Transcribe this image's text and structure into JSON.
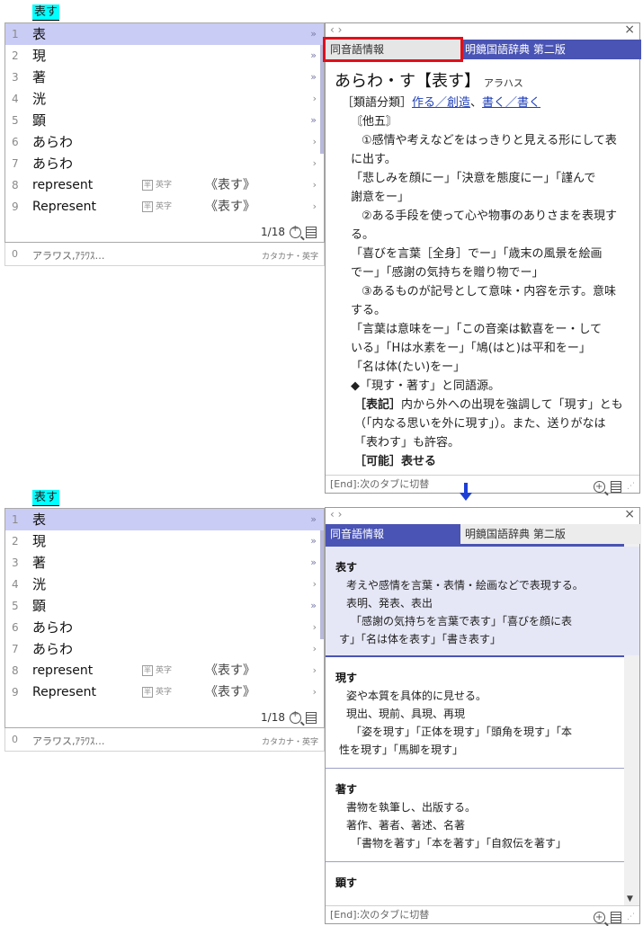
{
  "composition_text": "表す",
  "candidates": [
    {
      "num": "1",
      "word": "表",
      "kind": "",
      "annotation": "",
      "arrow": "»"
    },
    {
      "num": "2",
      "word": "現",
      "kind": "",
      "annotation": "",
      "arrow": "»"
    },
    {
      "num": "3",
      "word": "著",
      "kind": "",
      "annotation": "",
      "arrow": "»"
    },
    {
      "num": "4",
      "word": "洸",
      "kind": "",
      "annotation": "",
      "arrow": "›"
    },
    {
      "num": "5",
      "word": "顕",
      "kind": "",
      "annotation": "",
      "arrow": "»"
    },
    {
      "num": "6",
      "word": "あらわ",
      "kind": "",
      "annotation": "",
      "arrow": "›"
    },
    {
      "num": "7",
      "word": "あらわ",
      "kind": "",
      "annotation": "",
      "arrow": "›"
    },
    {
      "num": "8",
      "word": "represent",
      "kind_box": "半",
      "kind": "英字",
      "annotation": "《表す》",
      "arrow": "›"
    },
    {
      "num": "9",
      "word": "Represent",
      "kind_box": "半",
      "kind": "英字",
      "annotation": "《表す》",
      "arrow": "›"
    }
  ],
  "page_indicator": "1/18",
  "prediction": {
    "num": "0",
    "text": "アラワス,ｱﾗﾜｽ…",
    "type": "カタカナ・英字"
  },
  "dict": {
    "nav": "‹  ›",
    "close": "×",
    "tab_homonym": "同音語情報",
    "tab_meikyo": "明鏡国語辞典 第二版",
    "footer_hint": "[End]:次のタブに切替"
  },
  "meikyo_entry": {
    "headword": "あらわ・す【表す】",
    "reading": "アラハス",
    "category_label": "［類語分類］",
    "category_links": [
      "作る／創造",
      "書く／書く"
    ],
    "category_sep": "、",
    "pos": "〘他五〙",
    "lines": [
      "①感情や考えなどをはっきりと見える形にして表",
      "に出す。",
      "「悲しみを顔にー」「決意を態度にー」「謹んで",
      "謝意をー」",
      "②ある手段を使って心や物事のありさまを表現す",
      "る。",
      "「喜びを言葉［全身］でー」「歳末の風景を絵画",
      "でー」「感謝の気持ちを贈り物でー」",
      "③あるものが記号として意味・内容を示す。意味",
      "する。",
      "「言葉は意味をー」「この音楽は歓喜をー・して",
      "いる」「Hは水素をー」「鳩(はと)は平和をー」",
      "「名は体(たい)をー」"
    ],
    "note": "◆「現す・著す」と同語源。",
    "hyoki_label": "［表記］",
    "hyoki_lines": [
      "内から外への出現を強調して「現す」とも",
      "（「内なる思いを外に現す」）。また、送りがなは",
      "「表わす」も許容。"
    ],
    "kanou_label": "［可能］",
    "kanou": "表せる"
  },
  "homonym_entries": [
    {
      "head": "表す",
      "lines": [
        "考えや感情を言葉・表情・絵画などで表現する。",
        "表明、発表、表出"
      ],
      "examples": [
        "「感謝の気持ちを言葉で表す」「喜びを顔に表",
        "す」「名は体を表す」「書き表す」"
      ]
    },
    {
      "head": "現す",
      "lines": [
        "姿や本質を具体的に見せる。",
        "現出、現前、具現、再現"
      ],
      "examples": [
        "「姿を現す」「正体を現す」「頭角を現す」「本",
        "性を現す」「馬脚を現す」"
      ]
    },
    {
      "head": "著す",
      "lines": [
        "書物を執筆し、出版する。",
        "著作、著者、著述、名著"
      ],
      "examples": [
        "「書物を著す」「本を著す」「自叙伝を著す」"
      ]
    },
    {
      "head": "顕す",
      "lines": [],
      "examples": []
    }
  ]
}
